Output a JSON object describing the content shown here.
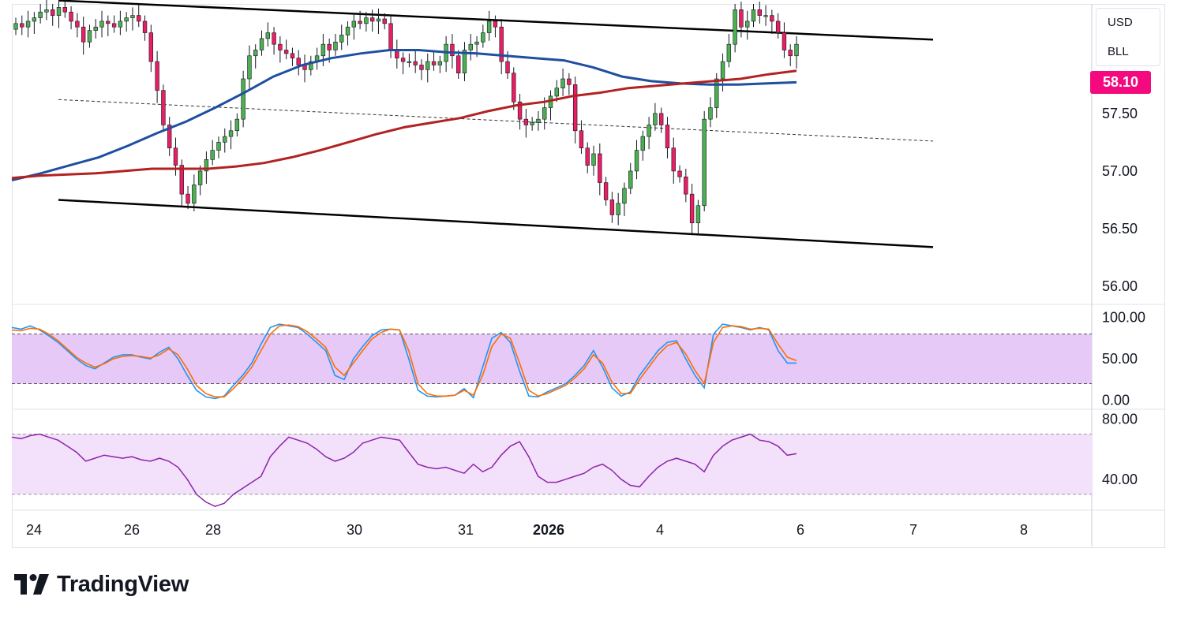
{
  "legend": {
    "currency": "USD",
    "unit": "BLL"
  },
  "last_price": {
    "label": "58.10",
    "color": "#f4097f"
  },
  "brand": {
    "name": "TradingView"
  },
  "colors": {
    "up": "#4caf50",
    "down": "#e91e63",
    "ma_fast": "#1e4fa0",
    "ma_slow": "#b22222",
    "stoch_k": "#2196f3",
    "stoch_d": "#ff6d00",
    "rsi": "#8e24aa",
    "band": "#e1bee7"
  },
  "chart_data": [
    {
      "type": "candlestick",
      "panel": "price",
      "y_ticks": [
        "56.00",
        "56.50",
        "57.00",
        "57.50"
      ],
      "ylim": [
        55.85,
        58.45
      ],
      "x_ticks": [
        "24",
        "26",
        "28",
        "30",
        "31",
        "2026",
        "4",
        "6",
        "7",
        "8"
      ],
      "close": [
        58.28,
        58.25,
        58.3,
        58.33,
        58.38,
        58.4,
        58.35,
        58.42,
        58.38,
        58.3,
        58.25,
        58.12,
        58.22,
        58.25,
        58.3,
        58.28,
        58.25,
        58.3,
        58.33,
        58.35,
        58.3,
        58.2,
        57.95,
        57.7,
        57.4,
        57.2,
        57.05,
        56.8,
        56.72,
        56.88,
        57.0,
        57.1,
        57.18,
        57.25,
        57.3,
        57.35,
        57.45,
        57.8,
        58.0,
        58.05,
        58.15,
        58.2,
        58.1,
        58.05,
        58.02,
        57.98,
        57.92,
        57.88,
        57.95,
        58.0,
        58.1,
        58.05,
        58.12,
        58.18,
        58.25,
        58.3,
        58.28,
        58.33,
        58.3,
        58.32,
        58.28,
        58.05,
        57.98,
        57.95,
        57.95,
        57.92,
        57.88,
        57.95,
        57.92,
        57.95,
        58.1,
        58.0,
        57.85,
        58.05,
        58.1,
        58.12,
        58.2,
        58.3,
        58.25,
        57.95,
        57.85,
        57.6,
        57.45,
        57.4,
        57.42,
        57.45,
        57.55,
        57.65,
        57.72,
        57.8,
        57.75,
        57.35,
        57.2,
        57.05,
        57.15,
        56.9,
        56.75,
        56.62,
        56.72,
        56.85,
        57.0,
        57.18,
        57.3,
        57.4,
        57.5,
        57.4,
        57.2,
        57.0,
        56.95,
        56.8,
        56.55,
        56.7,
        57.45,
        57.55,
        57.8,
        57.95,
        58.1,
        58.4,
        58.25,
        58.3,
        58.4,
        58.35,
        58.35,
        58.3,
        58.2,
        58.05,
        58.0,
        58.1
      ],
      "series": [
        {
          "name": "",
          "type": "line",
          "color": "#1e4fa0",
          "values": [
            56.92,
            56.98,
            57.05,
            57.12,
            57.22,
            57.33,
            57.43,
            57.55,
            57.68,
            57.82,
            57.92,
            57.98,
            58.02,
            58.05,
            58.05,
            58.03,
            58.02,
            58.0,
            57.98,
            57.96,
            57.9,
            57.82,
            57.78,
            57.76,
            57.75,
            57.75,
            57.76,
            57.77
          ]
        },
        {
          "name": "",
          "type": "line",
          "color": "#b22222",
          "values": [
            56.94,
            56.96,
            56.97,
            56.98,
            57.0,
            57.02,
            57.02,
            57.02,
            57.04,
            57.07,
            57.12,
            57.18,
            57.25,
            57.32,
            57.38,
            57.42,
            57.46,
            57.52,
            57.57,
            57.6,
            57.65,
            57.68,
            57.72,
            57.74,
            57.76,
            57.78,
            57.8,
            57.84,
            57.87
          ]
        }
      ],
      "channel": "descending parallel channel with dashed midline"
    },
    {
      "type": "line",
      "panel": "stochastic",
      "y_ticks": [
        "100.00",
        "50.00",
        "0.00"
      ],
      "ylim": [
        -10,
        115
      ],
      "band": [
        20,
        80
      ],
      "series": [
        {
          "name": "",
          "color": "#2196f3",
          "values": [
            88,
            86,
            90,
            85,
            78,
            70,
            60,
            50,
            42,
            38,
            45,
            52,
            55,
            55,
            52,
            50,
            58,
            64,
            50,
            30,
            12,
            4,
            2,
            5,
            18,
            30,
            45,
            68,
            88,
            92,
            90,
            88,
            80,
            70,
            60,
            30,
            25,
            50,
            65,
            78,
            85,
            86,
            85,
            50,
            12,
            5,
            4,
            5,
            6,
            14,
            3,
            40,
            75,
            82,
            70,
            35,
            5,
            4,
            10,
            15,
            20,
            30,
            42,
            60,
            40,
            15,
            5,
            10,
            30,
            45,
            60,
            70,
            72,
            50,
            30,
            15,
            80,
            92,
            90,
            88,
            85,
            88,
            85,
            60,
            45,
            45
          ]
        },
        {
          "name": "",
          "color": "#ff6d00",
          "values": [
            85,
            84,
            87,
            86,
            80,
            72,
            62,
            52,
            45,
            40,
            44,
            50,
            53,
            54,
            53,
            51,
            55,
            62,
            55,
            38,
            18,
            8,
            4,
            4,
            14,
            26,
            40,
            60,
            80,
            90,
            91,
            89,
            83,
            74,
            64,
            40,
            30,
            45,
            60,
            74,
            82,
            86,
            85,
            60,
            20,
            8,
            5,
            5,
            6,
            12,
            6,
            30,
            65,
            80,
            75,
            45,
            12,
            5,
            8,
            13,
            18,
            27,
            38,
            55,
            45,
            22,
            8,
            8,
            25,
            40,
            55,
            66,
            70,
            56,
            36,
            20,
            70,
            88,
            90,
            89,
            86,
            87,
            86,
            68,
            52,
            48
          ]
        }
      ]
    },
    {
      "type": "line",
      "panel": "rsi",
      "y_ticks": [
        "80.00",
        "40.00"
      ],
      "ylim": [
        20,
        86
      ],
      "band": [
        30,
        70
      ],
      "series": [
        {
          "name": "",
          "color": "#8e24aa",
          "values": [
            68,
            67,
            69,
            70,
            68,
            66,
            62,
            58,
            52,
            54,
            56,
            55,
            54,
            55,
            53,
            52,
            54,
            52,
            48,
            40,
            30,
            25,
            22,
            24,
            30,
            34,
            38,
            42,
            55,
            62,
            68,
            66,
            64,
            60,
            55,
            52,
            54,
            58,
            64,
            66,
            68,
            67,
            66,
            58,
            50,
            48,
            47,
            48,
            46,
            44,
            50,
            45,
            48,
            56,
            62,
            65,
            55,
            42,
            38,
            38,
            40,
            42,
            44,
            48,
            50,
            46,
            40,
            36,
            35,
            42,
            48,
            52,
            54,
            52,
            50,
            45,
            56,
            62,
            66,
            68,
            70,
            66,
            65,
            62,
            56,
            57
          ]
        }
      ]
    }
  ]
}
